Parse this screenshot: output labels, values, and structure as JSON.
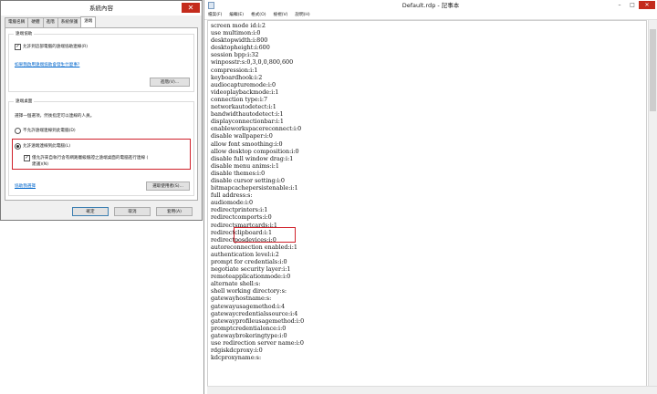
{
  "sysprops": {
    "title": "系統內容",
    "tabs": [
      "電腦名稱",
      "硬體",
      "進階",
      "系統保護",
      "遠端"
    ],
    "assist": {
      "legend": "遠端協助",
      "checkbox_label": "允許到這部電腦的遠端協助連線(R)",
      "link": "如果我啟用遠端協助會發生什麼事?",
      "advanced_btn": "進階(V)..."
    },
    "desktop": {
      "legend": "遠端桌面",
      "prompt": "選擇一個選項，然後指定可以連線的人員。",
      "opt_deny": "不允許遠端連線到此電腦(D)",
      "opt_allow": "允許遠端連線到此電腦(L)",
      "nla_line1": "僅允許來自執行含有網路層級驗證之遠端桌面的電腦進行連線 (",
      "nla_line2": "建議)(N)",
      "help_link": "協助我選擇",
      "select_users_btn": "選取使用者(S)..."
    },
    "buttons": {
      "ok": "確定",
      "cancel": "取消",
      "apply": "套用(A)"
    }
  },
  "notepad": {
    "title": "Default.rdp - 記事本",
    "menu": [
      "檔案(F)",
      "編輯(E)",
      "格式(O)",
      "檢視(V)",
      "說明(H)"
    ],
    "lines": [
      "screen mode id:i:2",
      "use multimon:i:0",
      "desktopwidth:i:800",
      "desktopheight:i:600",
      "session bpp:i:32",
      "winposstr:s:0,3,0,0,800,600",
      "compression:i:1",
      "keyboardhook:i:2",
      "audiocapturemode:i:0",
      "videoplaybackmode:i:1",
      "connection type:i:7",
      "networkautodetect:i:1",
      "bandwidthautodetect:i:1",
      "displayconnectionbar:i:1",
      "enableworkspacereconnect:i:0",
      "disable wallpaper:i:0",
      "allow font smoothing:i:0",
      "allow desktop composition:i:0",
      "disable full window drag:i:1",
      "disable menu anims:i:1",
      "disable themes:i:0",
      "disable cursor setting:i:0",
      "bitmapcachepersistenable:i:1",
      "full address:s:",
      "audiomode:i:0",
      "redirectprinters:i:1",
      "redirectcomports:i:0",
      "redirectsmartcards:i:1",
      "redirectclipboard:i:1",
      "redirectposdevices:i:0",
      "autoreconnection enabled:i:1",
      "authentication level:i:2",
      "prompt for credentials:i:0",
      "negotiate security layer:i:1",
      "remoteapplicationmode:i:0",
      "alternate shell:s:",
      "shell working directory:s:",
      "gatewayhostname:s:",
      "gatewayusagemethod:i:4",
      "gatewaycredentialssource:i:4",
      "gatewayprofileusagemethod:i:0",
      "promptcredentialonce:i:0",
      "gatewaybrokeringtype:i:0",
      "use redirection server name:i:0",
      "rdgiskdcproxy:i:0",
      "kdcproxyname:s:"
    ]
  },
  "colors": {
    "highlight_red": "#d0202a",
    "link_blue": "#0066cc",
    "close_red": "#c42b1c"
  }
}
